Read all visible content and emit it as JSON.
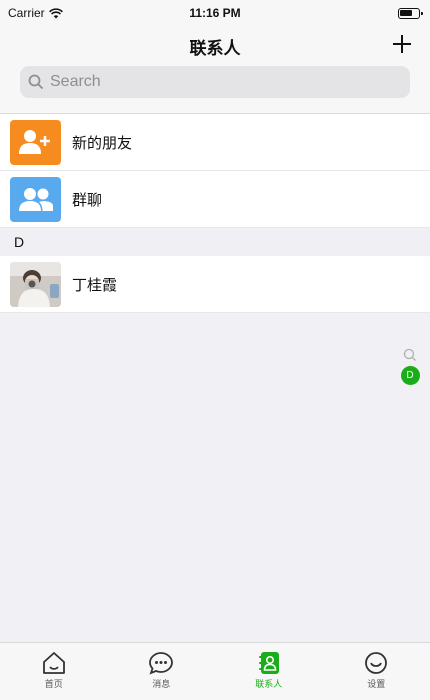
{
  "status_bar": {
    "carrier": "Carrier",
    "time": "11:16 PM"
  },
  "nav": {
    "title": "联系人",
    "search_placeholder": "Search"
  },
  "contacts": {
    "new_friends_label": "新的朋友",
    "group_chat_label": "群聊",
    "section_letter": "D",
    "contact_name": "丁桂霞"
  },
  "index_bar": {
    "letter": "D"
  },
  "tabs": [
    {
      "label": "首页",
      "icon": "home-icon"
    },
    {
      "label": "消息",
      "icon": "message-icon"
    },
    {
      "label": "联系人",
      "icon": "contacts-icon",
      "active": true
    },
    {
      "label": "设置",
      "icon": "settings-icon"
    }
  ],
  "colors": {
    "accent": "#1aad19",
    "new_friends": "#f68b1f",
    "group_chat": "#58a9ee"
  }
}
